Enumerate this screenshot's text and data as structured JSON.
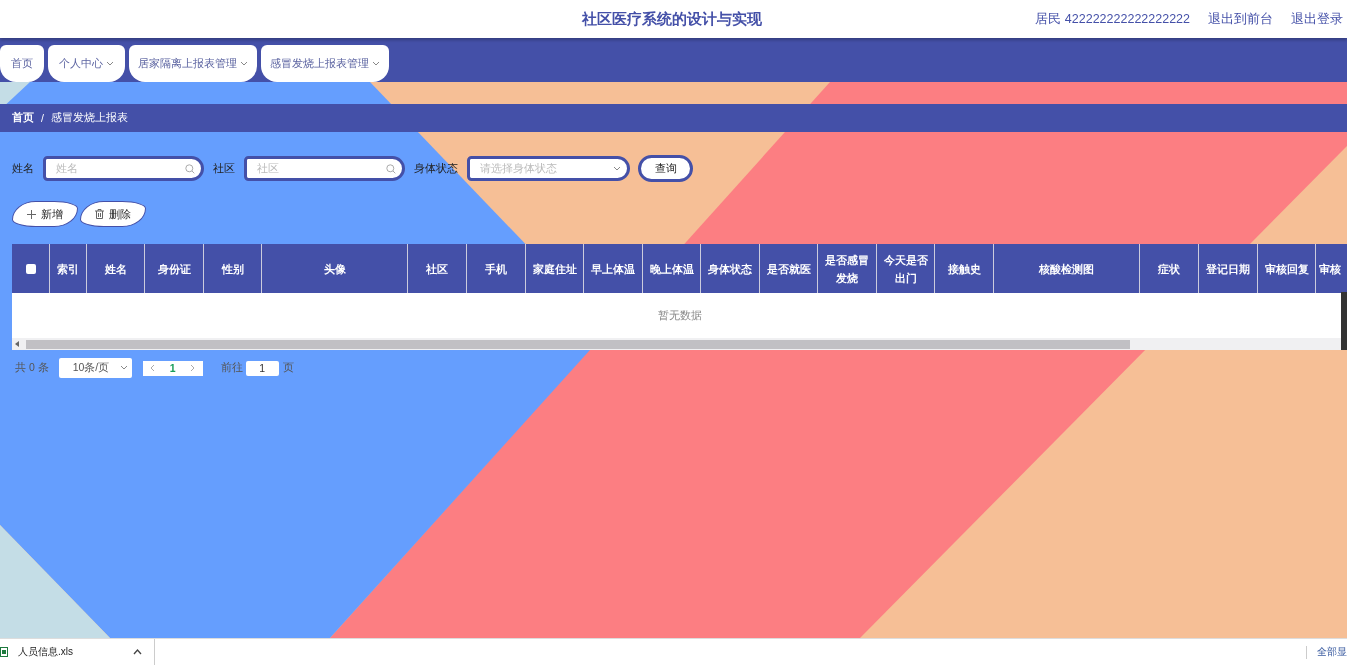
{
  "header": {
    "title": "社区医疗系统的设计与实现",
    "user": "居民 422222222222222222",
    "links": [
      "退出到前台",
      "退出登录"
    ]
  },
  "nav": [
    {
      "label": "首页",
      "dropdown": false
    },
    {
      "label": "个人中心",
      "dropdown": true
    },
    {
      "label": "居家隔离上报表管理",
      "dropdown": true
    },
    {
      "label": "感冒发烧上报表管理",
      "dropdown": true
    }
  ],
  "breadcrumb": {
    "items": [
      "首页",
      "感冒发烧上报表"
    ],
    "separator": "/"
  },
  "search": {
    "fields": [
      {
        "kind": "text",
        "label": "姓名",
        "placeholder": "姓名"
      },
      {
        "kind": "text",
        "label": "社区",
        "placeholder": "社区"
      },
      {
        "kind": "select",
        "label": "身体状态",
        "placeholder": "请选择身体状态"
      }
    ],
    "button": "查询"
  },
  "actions": [
    {
      "kind": "add",
      "label": "新增"
    },
    {
      "kind": "delete",
      "label": "删除"
    }
  ],
  "table": {
    "select_all": {
      "checked": false
    },
    "columns": [
      "索引",
      "姓名",
      "身份证",
      "性别",
      "头像",
      "社区",
      "手机",
      "家庭住址",
      "早上体温",
      "晚上体温",
      "身体状态",
      "是否就医",
      "是否感冒发烧",
      "今天是否出门",
      "接触史",
      "核酸检测图",
      "症状",
      "登记日期",
      "审核回复",
      "审核"
    ],
    "empty_text": "暂无数据"
  },
  "pagination": {
    "total": "共 0 条",
    "page_size": "10条/页",
    "pages": [
      {
        "label": "1",
        "selected": true
      }
    ],
    "goto_label": "前往",
    "goto_value": "1",
    "goto_suffix": "页"
  },
  "download_bar": {
    "file": "人员信息.xls",
    "show_all": "全部显"
  }
}
